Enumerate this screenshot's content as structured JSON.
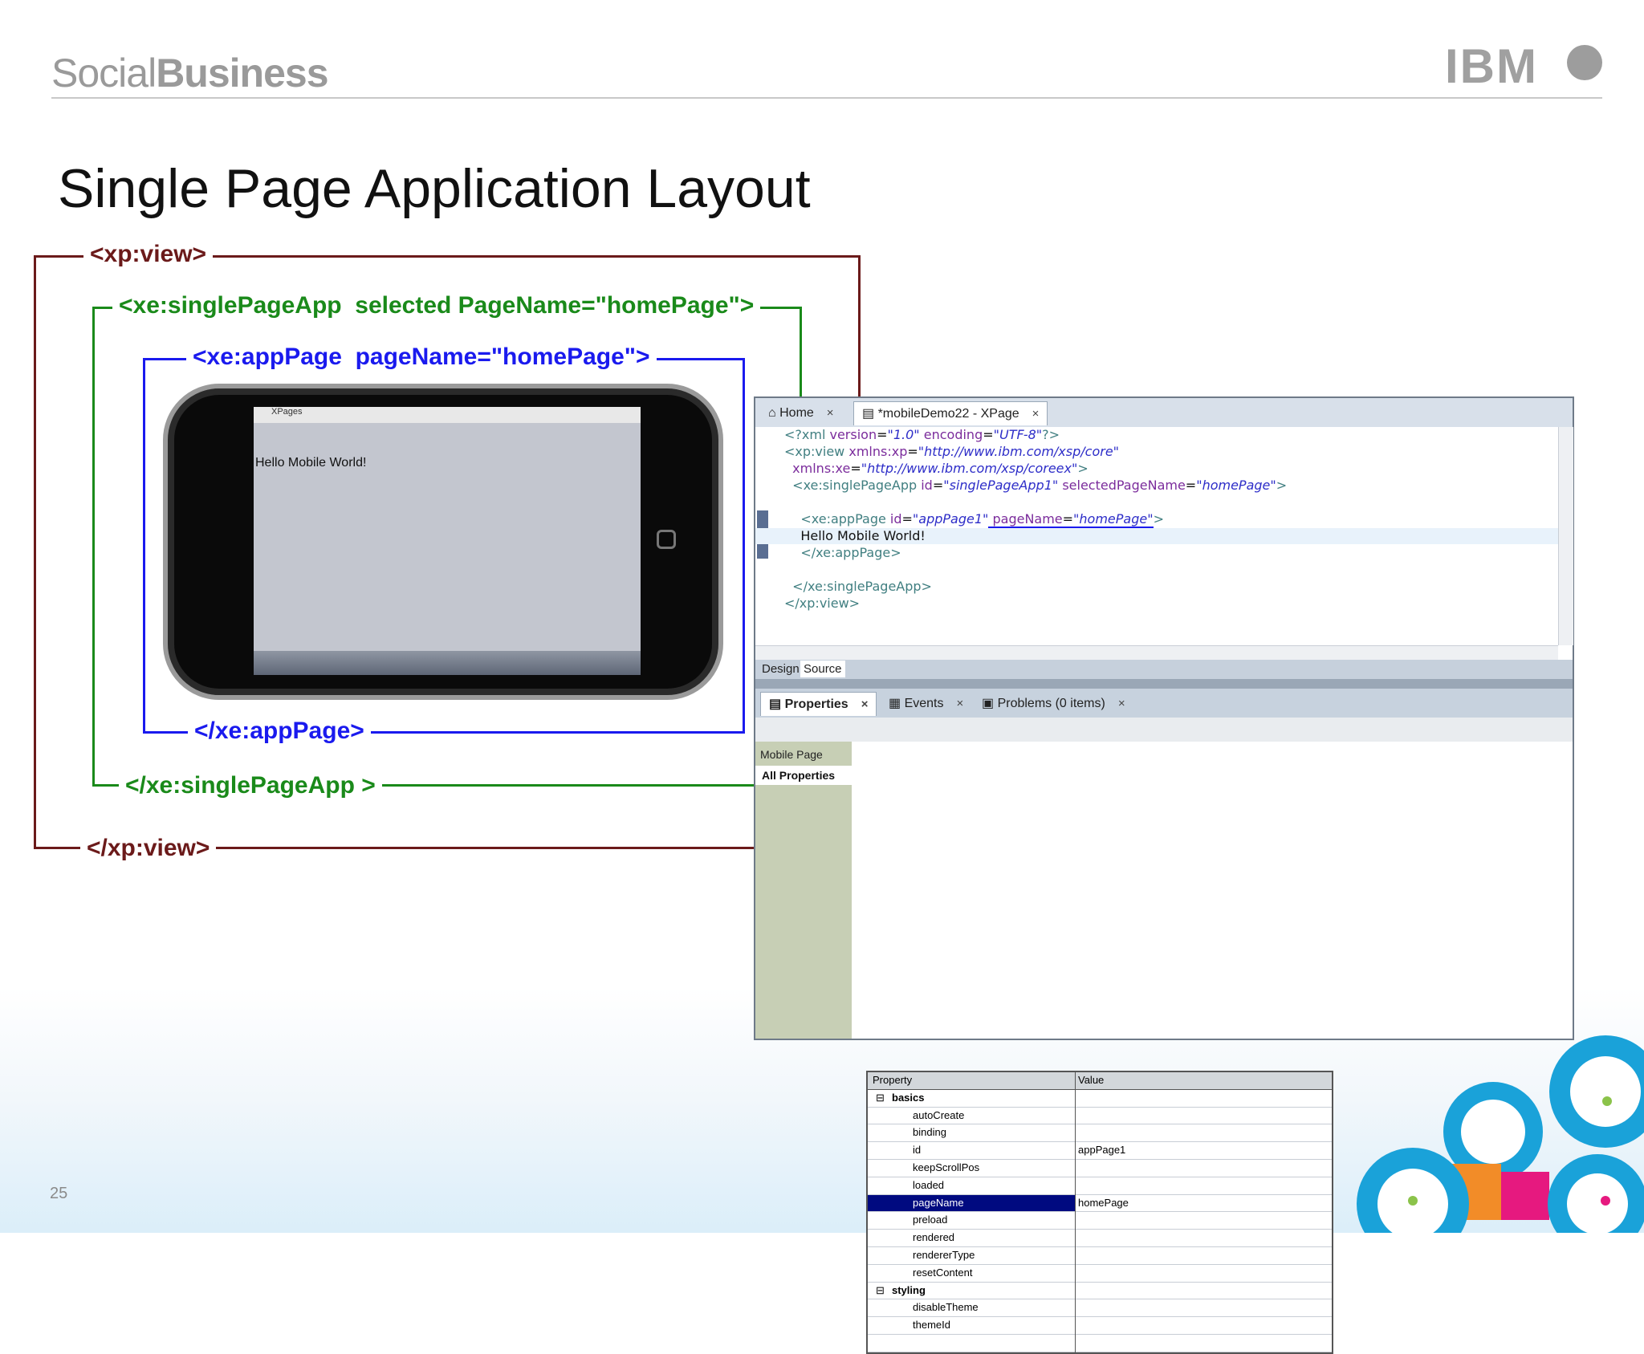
{
  "slide": {
    "brand_light": "Social",
    "brand_bold": "Business",
    "ibm": "IBM",
    "title": "Single Page Application Layout",
    "page_number": "25"
  },
  "diagram": {
    "xp_view_open": "<xp:view>",
    "xp_view_close": "</xp:view>",
    "single_open": "<xe:singlePageApp  selected PageName=\"homePage\">",
    "single_close": "</xe:singlePageApp >",
    "apppage_open": "<xe:appPage  pageName=\"homePage\">",
    "apppage_close": "</xe:appPage>",
    "phone_status": "XPages",
    "phone_text": "Hello Mobile World!",
    "colors": {
      "xp_view": "#6b1a1a",
      "single": "#1a8a1a",
      "apppage": "#1a1aee"
    }
  },
  "ide": {
    "tabs": [
      {
        "label": "Home",
        "close": "×"
      },
      {
        "label": "*mobileDemo22 - XPage",
        "close": "×"
      }
    ],
    "code": {
      "l1a": "<?xml ",
      "l1b": "version",
      "l1c": "=",
      "l1d": "\"1.0\"",
      "l1e": " encoding",
      "l1f": "=",
      "l1g": "\"UTF-8\"",
      "l1h": "?>",
      "l2a": "<xp:view ",
      "l2b": "xmlns:xp",
      "l2c": "=",
      "l2d": "\"http://www.ibm.com/xsp/core\"",
      "l3a": "  ",
      "l3b": "xmlns:xe",
      "l3c": "=",
      "l3d": "\"http://www.ibm.com/xsp/coreex\"",
      "l3e": ">",
      "l4a": "  <xe:singlePageApp ",
      "l4b": "id",
      "l4c": "=",
      "l4d": "\"singlePageApp1\"",
      "l4e": " selectedPageName",
      "l4f": "=",
      "l4g": "\"homePage\"",
      "l4h": ">",
      "l5a": "    <xe:appPage ",
      "l5b": "id",
      "l5c": "=",
      "l5d": "\"appPage1\"",
      "l5e": " pageName",
      "l5f": "=",
      "l5g": "\"homePage\"",
      "l5h": ">",
      "l6": "    Hello Mobile World!",
      "l7": "    </xe:appPage>",
      "l8": "  </xe:singlePageApp>",
      "l9": "</xp:view>"
    },
    "editor_tabs": {
      "design": "Design",
      "source": "Source"
    },
    "view_tabs": [
      {
        "label": "Properties",
        "close": "×"
      },
      {
        "label": "Events",
        "close": "×"
      },
      {
        "label": "Problems (0 items)",
        "close": "×"
      }
    ],
    "side_tabs": {
      "mobile_page": "Mobile Page",
      "all_properties": "All Properties"
    },
    "table_headers": {
      "property": "Property",
      "value": "Value"
    },
    "groups": {
      "basics": "basics",
      "styling": "styling"
    },
    "expander": "⊟",
    "rows": [
      {
        "name": "autoCreate",
        "value": ""
      },
      {
        "name": "binding",
        "value": ""
      },
      {
        "name": "id",
        "value": "appPage1"
      },
      {
        "name": "keepScrollPos",
        "value": ""
      },
      {
        "name": "loaded",
        "value": ""
      },
      {
        "name": "pageName",
        "value": "homePage"
      },
      {
        "name": "preload",
        "value": ""
      },
      {
        "name": "rendered",
        "value": ""
      },
      {
        "name": "rendererType",
        "value": ""
      },
      {
        "name": "resetContent",
        "value": ""
      }
    ],
    "styling_rows": [
      {
        "name": "disableTheme",
        "value": ""
      },
      {
        "name": "themeId",
        "value": ""
      }
    ],
    "selected_row": "pageName"
  }
}
